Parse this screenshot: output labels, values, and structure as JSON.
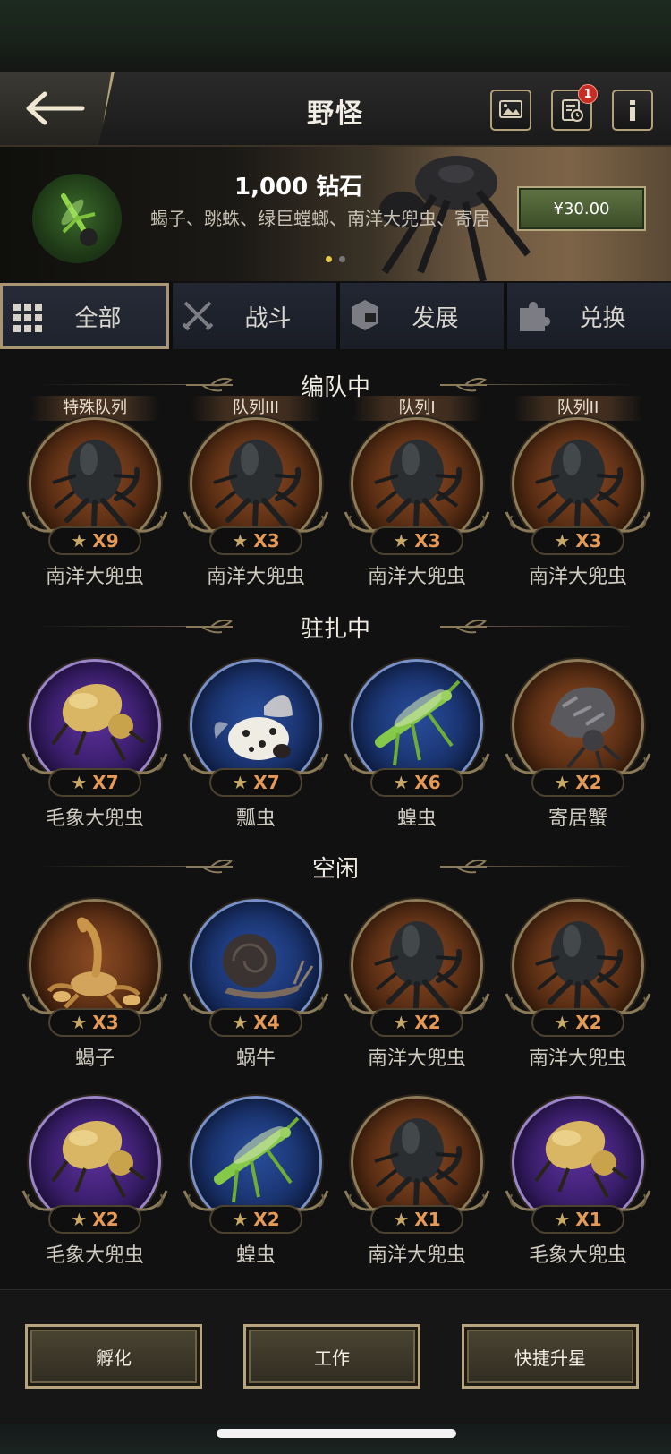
{
  "header": {
    "title": "野怪",
    "notification_count": "1"
  },
  "banner": {
    "title": "1,000 钻石",
    "description": "蝎子、跳蛛、绿巨螳螂、南洋大兜虫、寄居",
    "price": "¥30.00"
  },
  "tabs": [
    {
      "label": "全部",
      "icon": "grid-icon",
      "active": true
    },
    {
      "label": "战斗",
      "icon": "crossed-swords-icon",
      "active": false
    },
    {
      "label": "发展",
      "icon": "hexagon-build-icon",
      "active": false
    },
    {
      "label": "兑换",
      "icon": "puzzle-icon",
      "active": false
    }
  ],
  "sections": {
    "in_formation": {
      "title": "编队中",
      "cards": [
        {
          "queue": "特殊队列",
          "stars": "X9",
          "name": "南洋大兜虫",
          "bg": "brown",
          "creature": "beetle"
        },
        {
          "queue": "队列III",
          "stars": "X3",
          "name": "南洋大兜虫",
          "bg": "brown",
          "creature": "beetle"
        },
        {
          "queue": "队列I",
          "stars": "X3",
          "name": "南洋大兜虫",
          "bg": "brown",
          "creature": "beetle"
        },
        {
          "queue": "队列II",
          "stars": "X3",
          "name": "南洋大兜虫",
          "bg": "brown",
          "creature": "beetle"
        }
      ]
    },
    "stationed": {
      "title": "驻扎中",
      "cards": [
        {
          "stars": "X7",
          "name": "毛象大兜虫",
          "bg": "purple",
          "creature": "gold-beetle"
        },
        {
          "stars": "X7",
          "name": "瓢虫",
          "bg": "blue",
          "creature": "ladybug"
        },
        {
          "stars": "X6",
          "name": "蝗虫",
          "bg": "blue",
          "creature": "locust"
        },
        {
          "stars": "X2",
          "name": "寄居蟹",
          "bg": "brown",
          "creature": "hermit-crab"
        }
      ]
    },
    "idle": {
      "title": "空闲",
      "cards": [
        {
          "stars": "X3",
          "name": "蝎子",
          "bg": "brown",
          "creature": "scorpion"
        },
        {
          "stars": "X4",
          "name": "蜗牛",
          "bg": "blue",
          "creature": "snail"
        },
        {
          "stars": "X2",
          "name": "南洋大兜虫",
          "bg": "brown",
          "creature": "beetle"
        },
        {
          "stars": "X2",
          "name": "南洋大兜虫",
          "bg": "brown",
          "creature": "beetle"
        },
        {
          "stars": "X2",
          "name": "毛象大兜虫",
          "bg": "purple",
          "creature": "gold-beetle"
        },
        {
          "stars": "X2",
          "name": "蝗虫",
          "bg": "blue",
          "creature": "locust"
        },
        {
          "stars": "X1",
          "name": "南洋大兜虫",
          "bg": "brown",
          "creature": "beetle"
        },
        {
          "stars": "X1",
          "name": "毛象大兜虫",
          "bg": "purple",
          "creature": "gold-beetle"
        }
      ]
    }
  },
  "footer": {
    "hatch_label": "孵化",
    "work_label": "工作",
    "quick_star_label": "快捷升星"
  },
  "colors": {
    "accent_gold": "#b7a67d",
    "star_level": "#e69a55",
    "badge_red": "#c62d24",
    "price_green": "#4f6334"
  }
}
